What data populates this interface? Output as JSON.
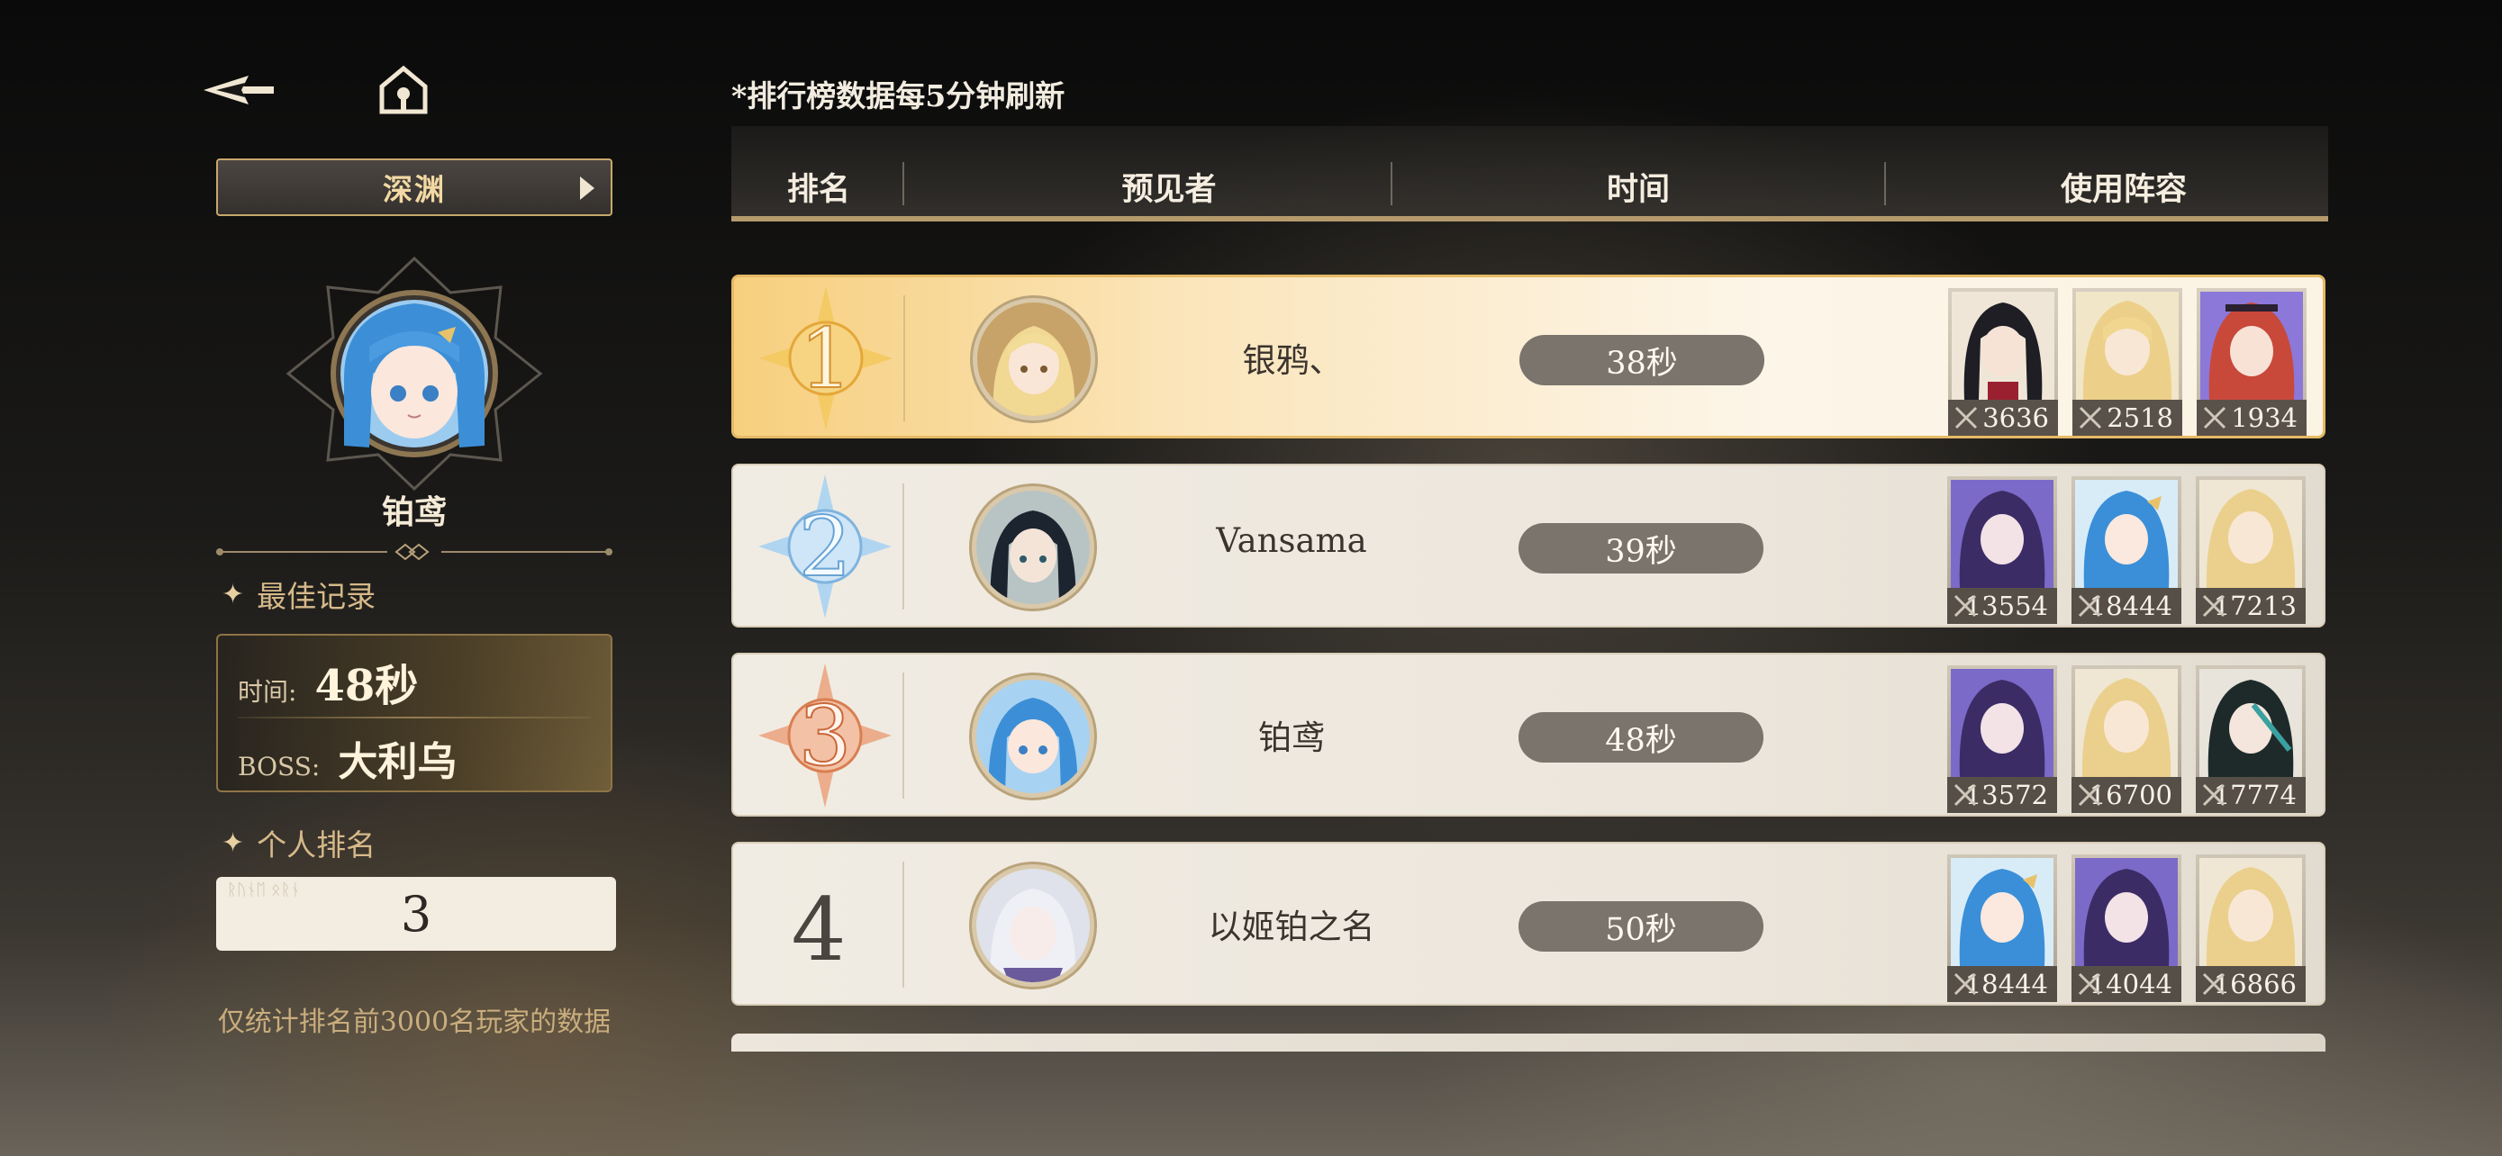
{
  "nav": {
    "back_icon": "back-arrow-icon",
    "home_icon": "home-icon"
  },
  "mode": {
    "label": "深渊"
  },
  "player": {
    "name": "铂鸢",
    "best_record_label": "最佳记录",
    "time_label": "时间:",
    "time_value": "48秒",
    "boss_label": "BOSS:",
    "boss_value": "大利乌",
    "personal_rank_label": "个人排名",
    "personal_rank_value": "3",
    "note": "仅统计排名前3000名玩家的数据"
  },
  "board": {
    "refresh_note": "*排行榜数据每5分钟刷新",
    "columns": [
      "排名",
      "预见者",
      "时间",
      "使用阵容"
    ],
    "rows": [
      {
        "rank": "1",
        "name": "银鸦、",
        "time": "38秒",
        "lineup": [
          "3636",
          "2518",
          "1934"
        ]
      },
      {
        "rank": "2",
        "name": "Vansama",
        "time": "39秒",
        "lineup": [
          "13554",
          "18444",
          "17213"
        ]
      },
      {
        "rank": "3",
        "name": "铂鸢",
        "time": "48秒",
        "lineup": [
          "13572",
          "16700",
          "17774"
        ]
      },
      {
        "rank": "4",
        "name": "以姬铂之名",
        "time": "50秒",
        "lineup": [
          "18444",
          "14044",
          "16866"
        ]
      }
    ]
  },
  "colors": {
    "gold": "#c8a86a",
    "rank1": "#f0b64a",
    "rank2": "#8fc3ea",
    "rank3": "#e08a5e"
  }
}
